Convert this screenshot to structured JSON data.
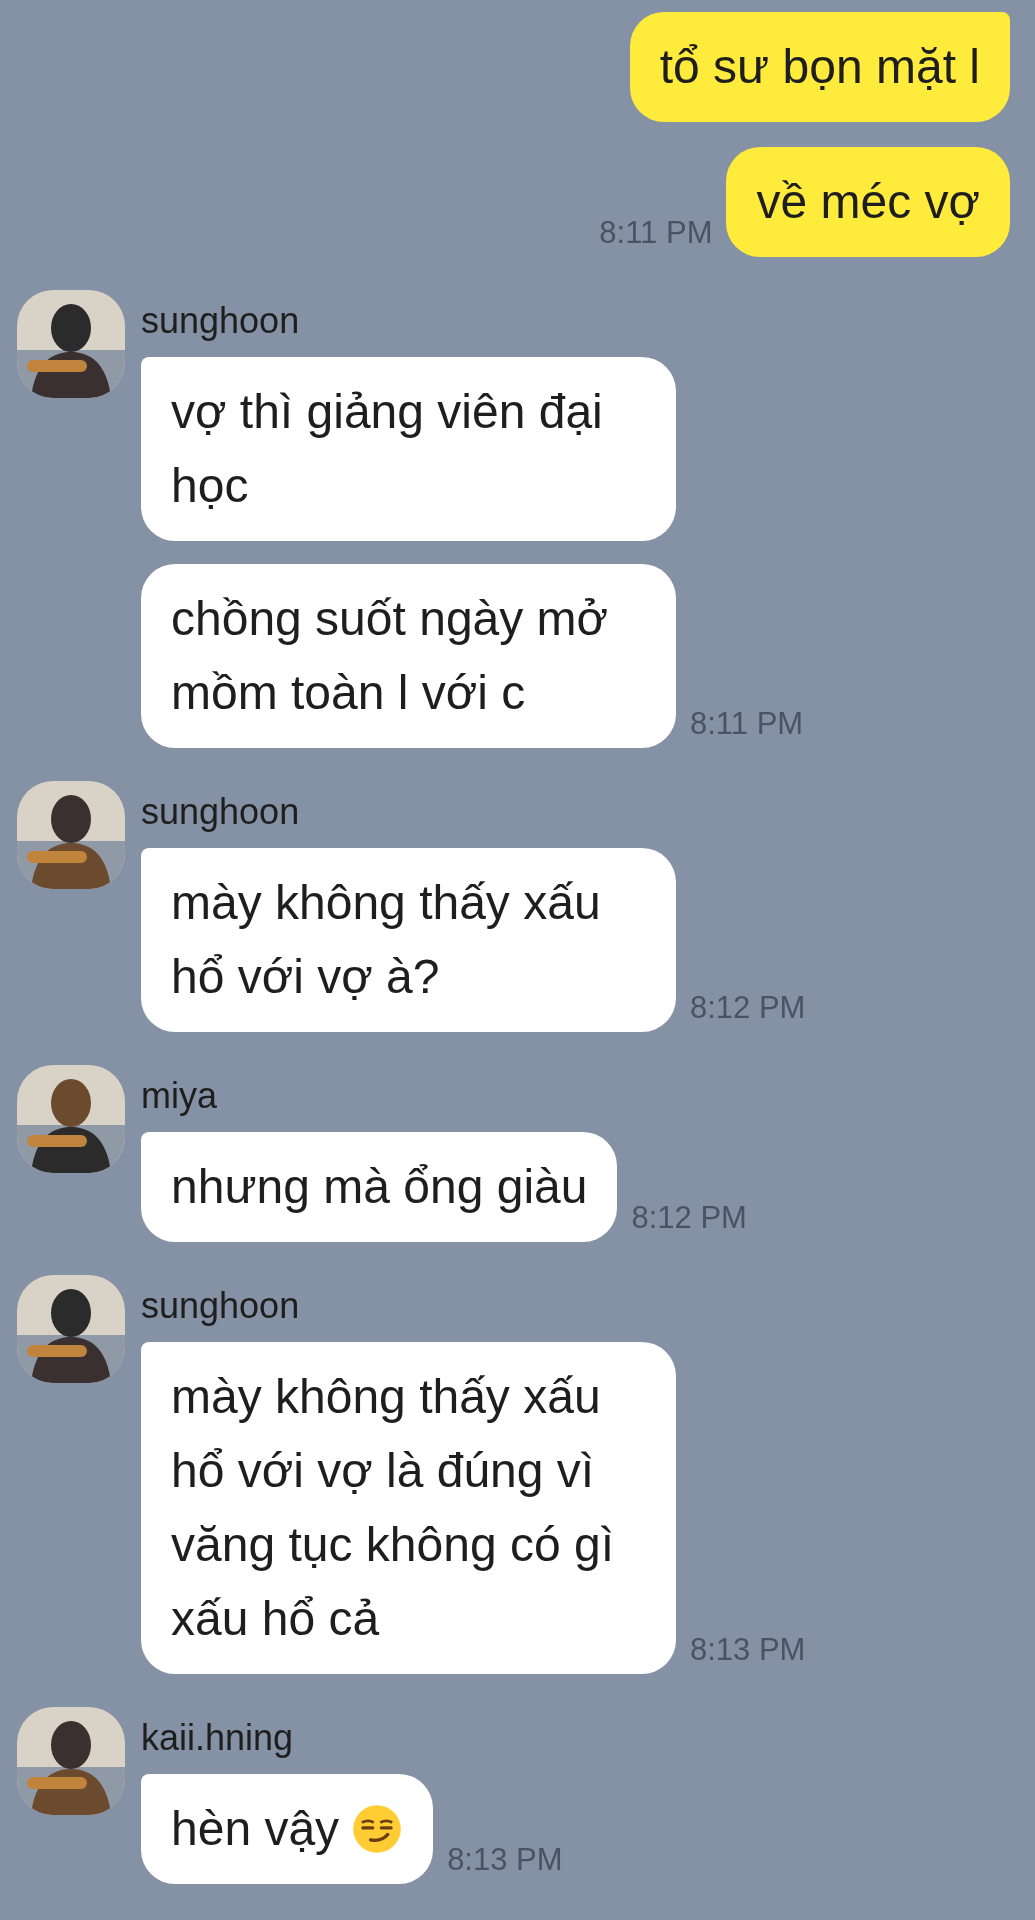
{
  "messages": [
    {
      "kind": "outgoing",
      "texts": [
        "tổ sư bọn mặt l",
        "về méc vợ"
      ],
      "time": "8:11 PM"
    },
    {
      "kind": "incoming",
      "sender": "sunghoon",
      "bubbles": [
        {
          "kind": "plain",
          "text": "vợ thì giảng viên đại học"
        },
        {
          "kind": "plain",
          "text": "chồng suốt ngày mở mồm toàn l với c"
        }
      ],
      "time": "8:11 PM"
    },
    {
      "kind": "incoming",
      "sender": "sunghoon",
      "bubbles": [
        {
          "kind": "plain",
          "text": "mày không thấy xấu hổ với vợ à?"
        }
      ],
      "time": "8:12 PM"
    },
    {
      "kind": "incoming",
      "sender": "miya",
      "bubbles": [
        {
          "kind": "plain",
          "text": "nhưng mà ổng giàu"
        }
      ],
      "time": "8:12 PM"
    },
    {
      "kind": "incoming",
      "sender": "sunghoon",
      "bubbles": [
        {
          "kind": "plain",
          "text": "mày không thấy xấu hổ với vợ là đúng vì văng tục không có gì xấu hổ cả"
        }
      ],
      "time": "8:13 PM"
    },
    {
      "kind": "incoming",
      "sender": "kaii.hning",
      "bubbles": [
        {
          "kind": "emoji",
          "text": "hèn vậy"
        }
      ],
      "time": "8:13 PM"
    }
  ]
}
